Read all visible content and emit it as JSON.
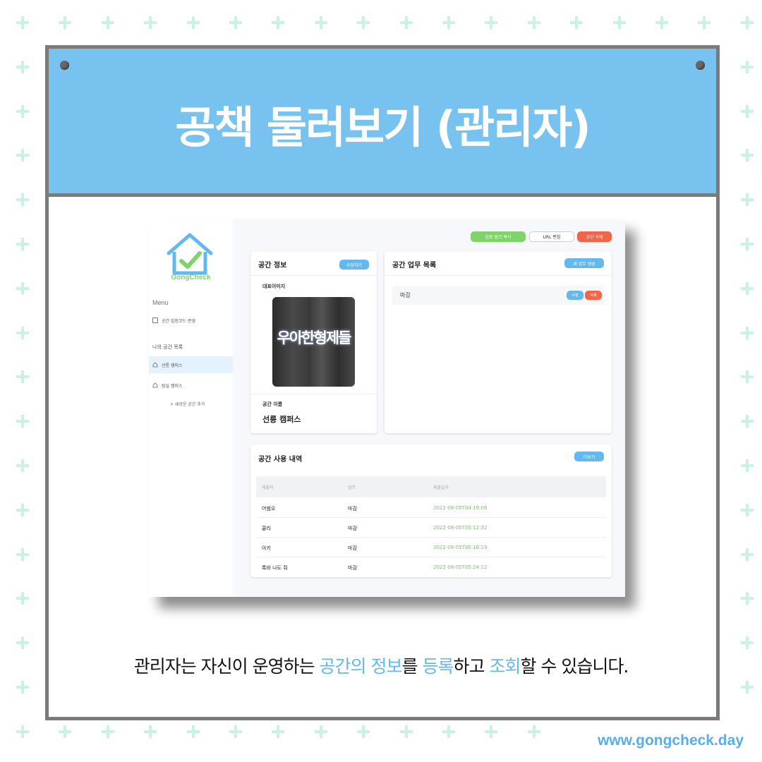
{
  "header": {
    "title": "공책 둘러보기 (관리자)"
  },
  "app": {
    "logo_name": "GongCheck",
    "sidebar": {
      "menu_title": "Menu",
      "entry_code_item": "공간 입장코드 변경",
      "my_spaces_title": "나의 공간 목록",
      "spaces": [
        "선릉 캠퍼스",
        "잠실 캠퍼스"
      ],
      "add_space": "+ 새로운 공간 추가"
    },
    "top_buttons": {
      "copy_link": "입장 링크 복사",
      "edit_url": "URL 편집",
      "delete_space": "공간 삭제"
    },
    "space_info": {
      "title": "공간 정보",
      "edit_button": "수정하기",
      "rep_image_label": "대표이미지",
      "rep_image_text": "우아한형제들",
      "space_name_label": "공간 이름",
      "space_name": "선릉 캠퍼스"
    },
    "tasks": {
      "title": "공간 업무 목록",
      "new_button": "새 업무 생성",
      "items": [
        {
          "name": "마감",
          "edit_label": "수정",
          "delete_label": "삭제"
        }
      ]
    },
    "history": {
      "title": "공간 사용 내역",
      "more_button": "더보기",
      "columns": [
        "제출자",
        "업무",
        "제출일자"
      ],
      "rows": [
        {
          "submitter": "어썸오",
          "task": "마감",
          "date": "2022-08-05T04:19:08"
        },
        {
          "submitter": "콜라",
          "task": "마감",
          "date": "2022-08-05T05:12:32"
        },
        {
          "submitter": "아키",
          "task": "마감",
          "date": "2022-08-05T05:18:19"
        },
        {
          "submitter": "록바 나도 줘",
          "task": "마감",
          "date": "2022-08-05T05:24:12"
        }
      ]
    }
  },
  "caption": {
    "part1": "관리자는 자신이 운영하는 ",
    "hl1": "공간의 정보",
    "part2": "를 ",
    "hl2": "등록",
    "part3": "하고 ",
    "hl3": "조회",
    "part4": "할 수 있습니다."
  },
  "site_url": "www.gongcheck.day",
  "colors": {
    "header_bg": "#77c2ee",
    "plus_color": "#c9f1e4",
    "frame_border": "#7b7b7b",
    "accent_blue": "#63b8ef",
    "accent_green": "#7ed36b",
    "accent_red": "#f36548"
  }
}
